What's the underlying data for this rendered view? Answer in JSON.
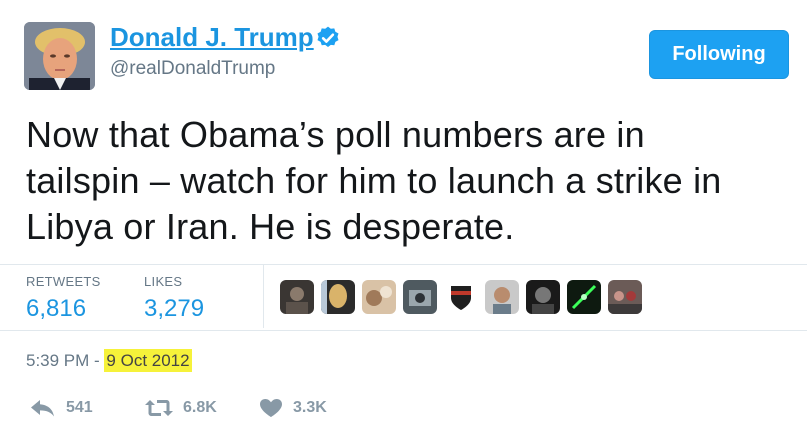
{
  "user": {
    "display_name": "Donald J. Trump",
    "handle": "@realDonaldTrump",
    "verified_icon": "verified-badge-icon"
  },
  "follow_button": {
    "label": "Following"
  },
  "tweet": {
    "lines": [
      "Now that Obama’s poll numbers are in",
      "tailspin – watch for him to launch a strike in",
      "Libya or Iran.  He is desperate."
    ]
  },
  "stats": {
    "retweets_label": "RETWEETS",
    "retweets_value": "6,816",
    "likes_label": "LIKES",
    "likes_value": "3,279"
  },
  "timestamp": {
    "time": "5:39 PM - ",
    "date": "9 Oct 2012"
  },
  "actions": {
    "reply_count": "541",
    "retweet_count": "6.8K",
    "like_count": "3.3K"
  },
  "colors": {
    "accent": "#1b95e0",
    "button": "#1da1f2",
    "muted": "#657786",
    "highlight": "#f6f23a"
  }
}
